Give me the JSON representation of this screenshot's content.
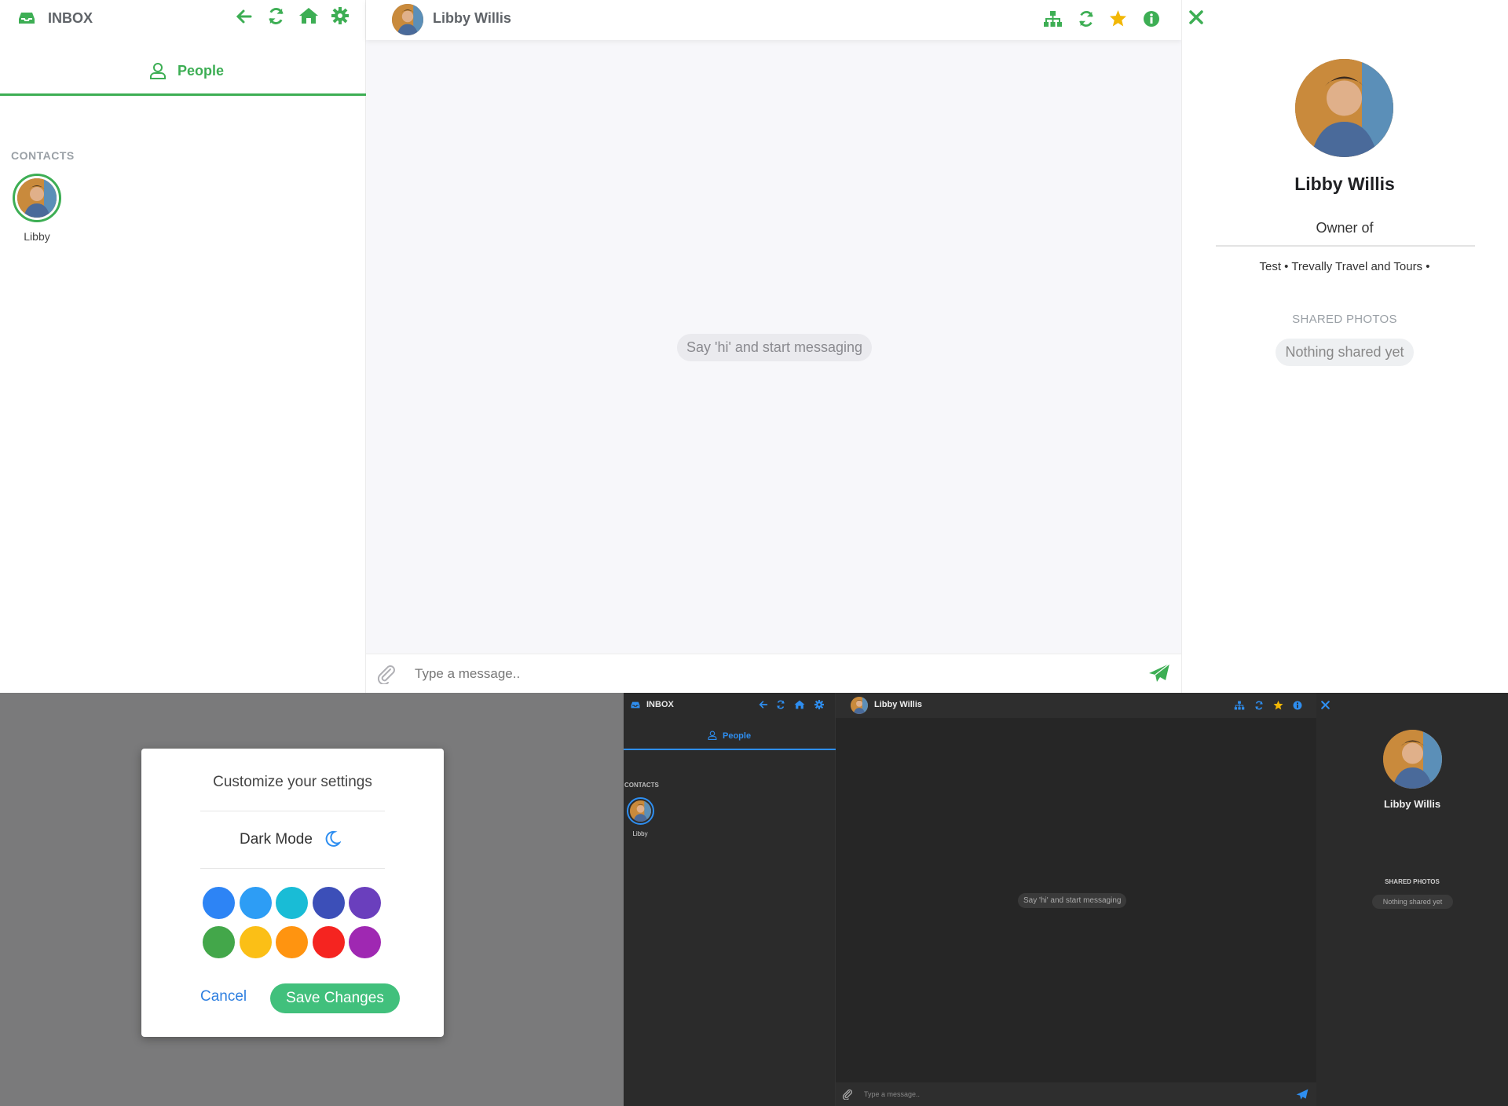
{
  "light": {
    "sidebar": {
      "title": "INBOX",
      "tab_label": "People",
      "contacts_heading": "CONTACTS",
      "contacts": [
        {
          "name": "Libby"
        }
      ]
    },
    "chat": {
      "contact_name": "Libby Willis",
      "empty_message": "Say 'hi' and start messaging",
      "input_placeholder": "Type a message.."
    },
    "info": {
      "name": "Libby Willis",
      "role": "Owner of",
      "organizations": "Test • Trevally Travel and Tours •",
      "shared_heading": "SHARED PHOTOS",
      "shared_empty": "Nothing shared yet"
    },
    "accent": "#3dae54"
  },
  "settings_modal": {
    "title": "Customize your settings",
    "dark_mode_label": "Dark Mode",
    "color_swatches": [
      "#2d84f5",
      "#2d9df5",
      "#19bcd6",
      "#3c4fb8",
      "#6a3fbd",
      "#43a74a",
      "#fbbf16",
      "#ff9410",
      "#f52420",
      "#9f28b2"
    ],
    "cancel_label": "Cancel",
    "save_label": "Save Changes"
  },
  "dark": {
    "sidebar": {
      "title": "INBOX",
      "tab_label": "People",
      "contacts_heading": "CONTACTS",
      "contacts": [
        {
          "name": "Libby"
        }
      ]
    },
    "chat": {
      "contact_name": "Libby Willis",
      "empty_message": "Say 'hi' and start messaging",
      "input_placeholder": "Type a message.."
    },
    "info": {
      "name": "Libby Willis",
      "shared_heading": "SHARED PHOTOS",
      "shared_empty": "Nothing shared yet"
    },
    "accent": "#2e8ef0"
  }
}
